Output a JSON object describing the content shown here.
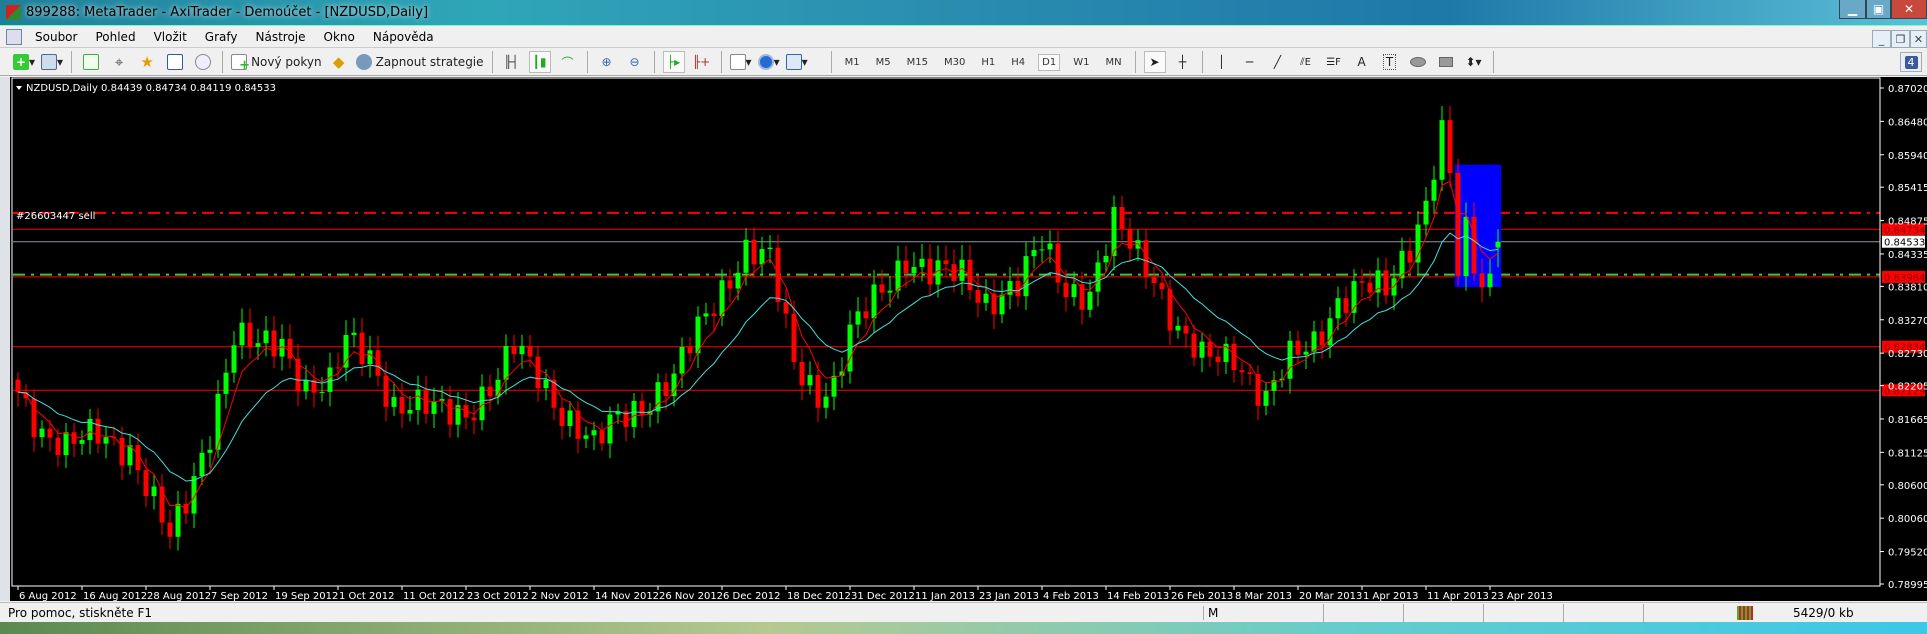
{
  "window": {
    "title": "899288: MetaTrader - AxiTrader - Demoúčet - [NZDUSD,Daily]"
  },
  "menu": [
    "Soubor",
    "Pohled",
    "Vložit",
    "Grafy",
    "Nástroje",
    "Okno",
    "Nápověda"
  ],
  "toolbar": {
    "new_order": "Nový pokyn",
    "strategies": "Zapnout strategie",
    "timeframes": [
      "M1",
      "M5",
      "M15",
      "M30",
      "H1",
      "H4",
      "D1",
      "W1",
      "MN"
    ],
    "active_timeframe": "D1",
    "notifications": "4"
  },
  "chart": {
    "header": "NZDUSD,Daily  0.84439 0.84734 0.84119 0.84533",
    "order_label": "#26603447 sell"
  },
  "status": {
    "help": "Pro pomoc, stiskněte F1",
    "profile": "M",
    "traffic": "5429/0 kb"
  },
  "chart_data": {
    "type": "candlestick",
    "symbol": "NZDUSD",
    "timeframe": "Daily",
    "ylim": [
      0.78995,
      0.8702
    ],
    "yticks": [
      "0.87020",
      "0.86480",
      "0.85940",
      "0.85415",
      "0.84875",
      "0.84335",
      "0.83810",
      "0.83270",
      "0.82730",
      "0.82205",
      "0.81665",
      "0.81125",
      "0.80600",
      "0.80060",
      "0.79520",
      "0.78995"
    ],
    "xticks": [
      {
        "i": 0,
        "label": "6 Aug 2012"
      },
      {
        "i": 8,
        "label": "16 Aug 2012"
      },
      {
        "i": 16,
        "label": "28 Aug 2012"
      },
      {
        "i": 24,
        "label": "7 Sep 2012"
      },
      {
        "i": 32,
        "label": "19 Sep 2012"
      },
      {
        "i": 40,
        "label": "1 Oct 2012"
      },
      {
        "i": 48,
        "label": "11 Oct 2012"
      },
      {
        "i": 56,
        "label": "23 Oct 2012"
      },
      {
        "i": 64,
        "label": "2 Nov 2012"
      },
      {
        "i": 72,
        "label": "14 Nov 2012"
      },
      {
        "i": 80,
        "label": "26 Nov 2012"
      },
      {
        "i": 88,
        "label": "6 Dec 2012"
      },
      {
        "i": 96,
        "label": "18 Dec 2012"
      },
      {
        "i": 104,
        "label": "31 Dec 2012"
      },
      {
        "i": 112,
        "label": "11 Jan 2013"
      },
      {
        "i": 120,
        "label": "23 Jan 2013"
      },
      {
        "i": 128,
        "label": "4 Feb 2013"
      },
      {
        "i": 136,
        "label": "14 Feb 2013"
      },
      {
        "i": 144,
        "label": "26 Feb 2013"
      },
      {
        "i": 152,
        "label": "8 Mar 2013"
      },
      {
        "i": 160,
        "label": "20 Mar 2013"
      },
      {
        "i": 168,
        "label": "1 Apr 2013"
      },
      {
        "i": 176,
        "label": "11 Apr 2013"
      },
      {
        "i": 184,
        "label": "23 Apr 2013"
      }
    ],
    "bar_count": 186,
    "close_anchors": [
      [
        0,
        0.821
      ],
      [
        3,
        0.815
      ],
      [
        6,
        0.812
      ],
      [
        10,
        0.814
      ],
      [
        14,
        0.812
      ],
      [
        17,
        0.803
      ],
      [
        19,
        0.797
      ],
      [
        21,
        0.803
      ],
      [
        24,
        0.815
      ],
      [
        27,
        0.83
      ],
      [
        30,
        0.828
      ],
      [
        33,
        0.829
      ],
      [
        36,
        0.822
      ],
      [
        39,
        0.822
      ],
      [
        41,
        0.829
      ],
      [
        44,
        0.827
      ],
      [
        47,
        0.819
      ],
      [
        52,
        0.818
      ],
      [
        56,
        0.818
      ],
      [
        60,
        0.823
      ],
      [
        62,
        0.828
      ],
      [
        65,
        0.824
      ],
      [
        68,
        0.818
      ],
      [
        72,
        0.812
      ],
      [
        75,
        0.817
      ],
      [
        79,
        0.82
      ],
      [
        82,
        0.823
      ],
      [
        85,
        0.831
      ],
      [
        88,
        0.838
      ],
      [
        91,
        0.844
      ],
      [
        94,
        0.842
      ],
      [
        97,
        0.826
      ],
      [
        100,
        0.821
      ],
      [
        102,
        0.822
      ],
      [
        104,
        0.83
      ],
      [
        107,
        0.836
      ],
      [
        111,
        0.843
      ],
      [
        114,
        0.84
      ],
      [
        118,
        0.84
      ],
      [
        121,
        0.836
      ],
      [
        125,
        0.838
      ],
      [
        128,
        0.845
      ],
      [
        131,
        0.838
      ],
      [
        134,
        0.837
      ],
      [
        137,
        0.848
      ],
      [
        139,
        0.845
      ],
      [
        142,
        0.84
      ],
      [
        145,
        0.831
      ],
      [
        148,
        0.826
      ],
      [
        152,
        0.827
      ],
      [
        156,
        0.82
      ],
      [
        159,
        0.826
      ],
      [
        162,
        0.829
      ],
      [
        165,
        0.836
      ],
      [
        168,
        0.838
      ],
      [
        171,
        0.837
      ],
      [
        174,
        0.845
      ],
      [
        176,
        0.852
      ],
      [
        177,
        0.858
      ],
      [
        178,
        0.863
      ],
      [
        179,
        0.856
      ],
      [
        180,
        0.84
      ],
      [
        181,
        0.846
      ],
      [
        182,
        0.841
      ],
      [
        183,
        0.838
      ],
      [
        184,
        0.839
      ]
    ],
    "last_bar": {
      "open": 0.84439,
      "high": 0.84734,
      "low": 0.84119,
      "close": 0.84533
    },
    "moving_averages": [
      {
        "name": "fast",
        "period": 5,
        "color": "#ff0000"
      },
      {
        "name": "slow",
        "period": 14,
        "color": "#40e0e0"
      }
    ],
    "hlines": [
      {
        "price": 0.85,
        "color": "#ff0000",
        "style": "dashdot"
      },
      {
        "price": 0.84734,
        "color": "#ff0000",
        "style": "solid",
        "label": "0.84734"
      },
      {
        "price": 0.84533,
        "color": "#8a96a4",
        "style": "solid",
        "label": "0.84533",
        "bid": true
      },
      {
        "price": 0.84,
        "color": "#3cc83c",
        "style": "dashdot"
      },
      {
        "price": 0.83964,
        "color": "#ff0000",
        "style": "solid",
        "label": "0.83964"
      },
      {
        "price": 0.82834,
        "color": "#ff0000",
        "style": "solid",
        "label": "0.82834"
      },
      {
        "price": 0.82129,
        "color": "#ff0000",
        "style": "solid",
        "label": "0.82129"
      }
    ],
    "rectangle": {
      "from_bar": 179.6,
      "to_bar": 185.4,
      "top": 0.8578,
      "bottom": 0.838,
      "color": "#0000ff"
    },
    "colors": {
      "bull": "#00ff00",
      "bear": "#ff0000",
      "background": "#000000"
    }
  }
}
